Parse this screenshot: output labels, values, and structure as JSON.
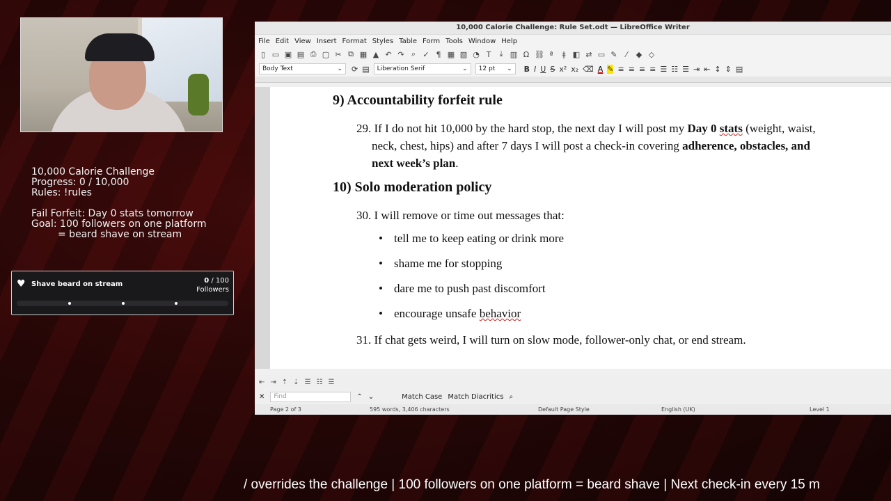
{
  "stream_overlay": {
    "info_lines": [
      "10,000 Calorie Challenge",
      "Progress: 0 / 10,000",
      "Rules: !rules"
    ],
    "forfeit_lines": [
      "Fail Forfeit: Day 0 stats tomorrow",
      "Goal: 100 followers on one platform",
      "= beard shave on stream"
    ],
    "goal_widget": {
      "title": "Shave beard on stream",
      "current": "0",
      "target": "/ 100",
      "unit": "Followers",
      "progress_fraction": 0
    },
    "ticker": "/ overrides the challenge | 100 followers on one platform = beard shave | Next check-in every 15 m"
  },
  "writer": {
    "window_title": "10,000 Calorie Challenge: Rule Set.odt — LibreOffice Writer",
    "menu": [
      "File",
      "Edit",
      "View",
      "Insert",
      "Format",
      "Styles",
      "Table",
      "Form",
      "Tools",
      "Window",
      "Help"
    ],
    "paragraph_style": "Body Text",
    "font_name": "Liberation Serif",
    "font_size": "12 pt",
    "document": {
      "heading_9": "9) Accountability forfeit rule",
      "rule_29": {
        "part1": "29. If I do not hit 10,000 by the hard stop, the next day I will post my ",
        "bold1": "Day 0 ",
        "bold1_squiggle": "stats",
        "part2": " (weight, waist,",
        "line2_plain": "neck, chest, hips) and after 7 days I will post a check-in covering ",
        "bold2": "adherence, obstacles, and",
        "line3_bold": "next week’s plan",
        "line3_end": "."
      },
      "heading_10": "10) Solo moderation policy",
      "rule_30": "30. I will remove or time out messages that:",
      "bullets": [
        "tell me to keep eating or drink more",
        "shame me for stopping",
        "dare me to push past discomfort",
        "encourage unsafe "
      ],
      "bullet4_squiggle": "behavior",
      "rule_31": "31. If chat gets weird, I will turn on slow mode, follower-only chat, or end stream."
    },
    "find": {
      "placeholder": "Find",
      "match_case": "Match Case",
      "match_diacritics": "Match Diacritics"
    },
    "status": {
      "page": "Page 2 of 3",
      "words": "595 words, 3,406 characters",
      "page_style": "Default Page Style",
      "language": "English (UK)",
      "level": "Level 1"
    }
  }
}
